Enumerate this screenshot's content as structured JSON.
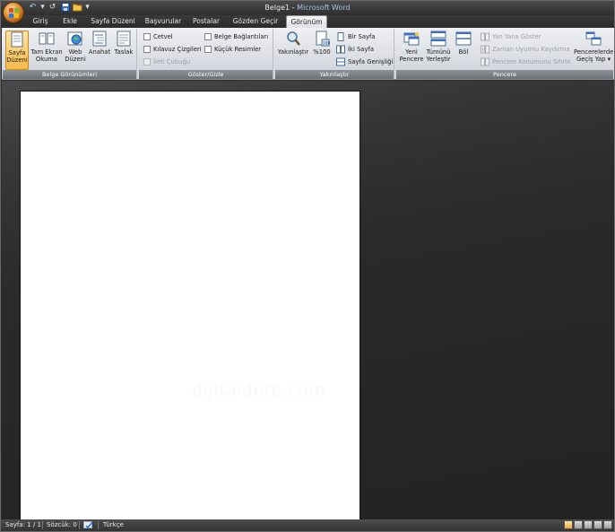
{
  "window": {
    "doc_name": "Belge1",
    "separator": " - ",
    "app_name": "Microsoft Word"
  },
  "quick_access": {
    "undo_icon": "undo-arrow-icon",
    "redo_icon": "redo-arrow-icon",
    "save_icon": "save-disk-icon",
    "open_icon": "open-folder-icon",
    "customize_icon": "chevron-down-icon"
  },
  "tabs": [
    {
      "label": "Giriş"
    },
    {
      "label": "Ekle"
    },
    {
      "label": "Sayfa Düzeni"
    },
    {
      "label": "Başvurular"
    },
    {
      "label": "Postalar"
    },
    {
      "label": "Gözden Geçir"
    },
    {
      "label": "Görünüm"
    }
  ],
  "active_tab": "Görünüm",
  "ribbon": {
    "groups": {
      "belge_gorunumleri": {
        "label": "Belge Görünümleri",
        "buttons": [
          {
            "line1": "Sayfa",
            "line2": "Düzeni",
            "active": true
          },
          {
            "line1": "Tam Ekran",
            "line2": "Okuma"
          },
          {
            "line1": "Web",
            "line2": "Düzeni"
          },
          {
            "line1": "Anahat",
            "line2": ""
          },
          {
            "line1": "Taslak",
            "line2": ""
          }
        ]
      },
      "goster_gizle": {
        "label": "Göster/Gizle",
        "items": [
          {
            "label": "Cetvel",
            "checked": false,
            "enabled": true
          },
          {
            "label": "Kılavuz Çizgileri",
            "checked": false,
            "enabled": true
          },
          {
            "label": "İleti Çubuğu",
            "checked": false,
            "enabled": false
          },
          {
            "label": "Belge Bağlantıları",
            "checked": false,
            "enabled": true
          },
          {
            "label": "Küçük Resimler",
            "checked": false,
            "enabled": true
          }
        ]
      },
      "yakinlastir": {
        "label": "Yakınlaştır",
        "zoom_label": "Yakınlaştır",
        "zoom100_label": "%100",
        "items": [
          {
            "label": "Bir Sayfa"
          },
          {
            "label": "İki Sayfa"
          },
          {
            "label": "Sayfa Genişliği"
          }
        ]
      },
      "pencere": {
        "label": "Pencere",
        "buttons": [
          {
            "line1": "Yeni",
            "line2": "Pencere"
          },
          {
            "line1": "Tümünü",
            "line2": "Yerleştir"
          },
          {
            "line1": "Böl",
            "line2": ""
          },
          {
            "line1": "Pencerelerde",
            "line2": "Geçiş Yap ▾"
          }
        ],
        "items": [
          {
            "label": "Yan Yana Göster",
            "enabled": false
          },
          {
            "label": "Zaman Uyumlu Kaydırma",
            "enabled": false
          },
          {
            "label": "Pencere Konumunu Sıfırla",
            "enabled": false
          }
        ]
      }
    }
  },
  "document": {
    "watermark": "dijitaldere.com"
  },
  "status": {
    "page": "Sayfa: 1 / 1",
    "words": "Sözcük: 0",
    "language": "Türkçe"
  },
  "colors": {
    "accent": "#f7b94a",
    "ribbon_bg": "#dcdfe4",
    "chrome_dark": "#2b2b2b",
    "title_app": "#a9c2e8"
  }
}
